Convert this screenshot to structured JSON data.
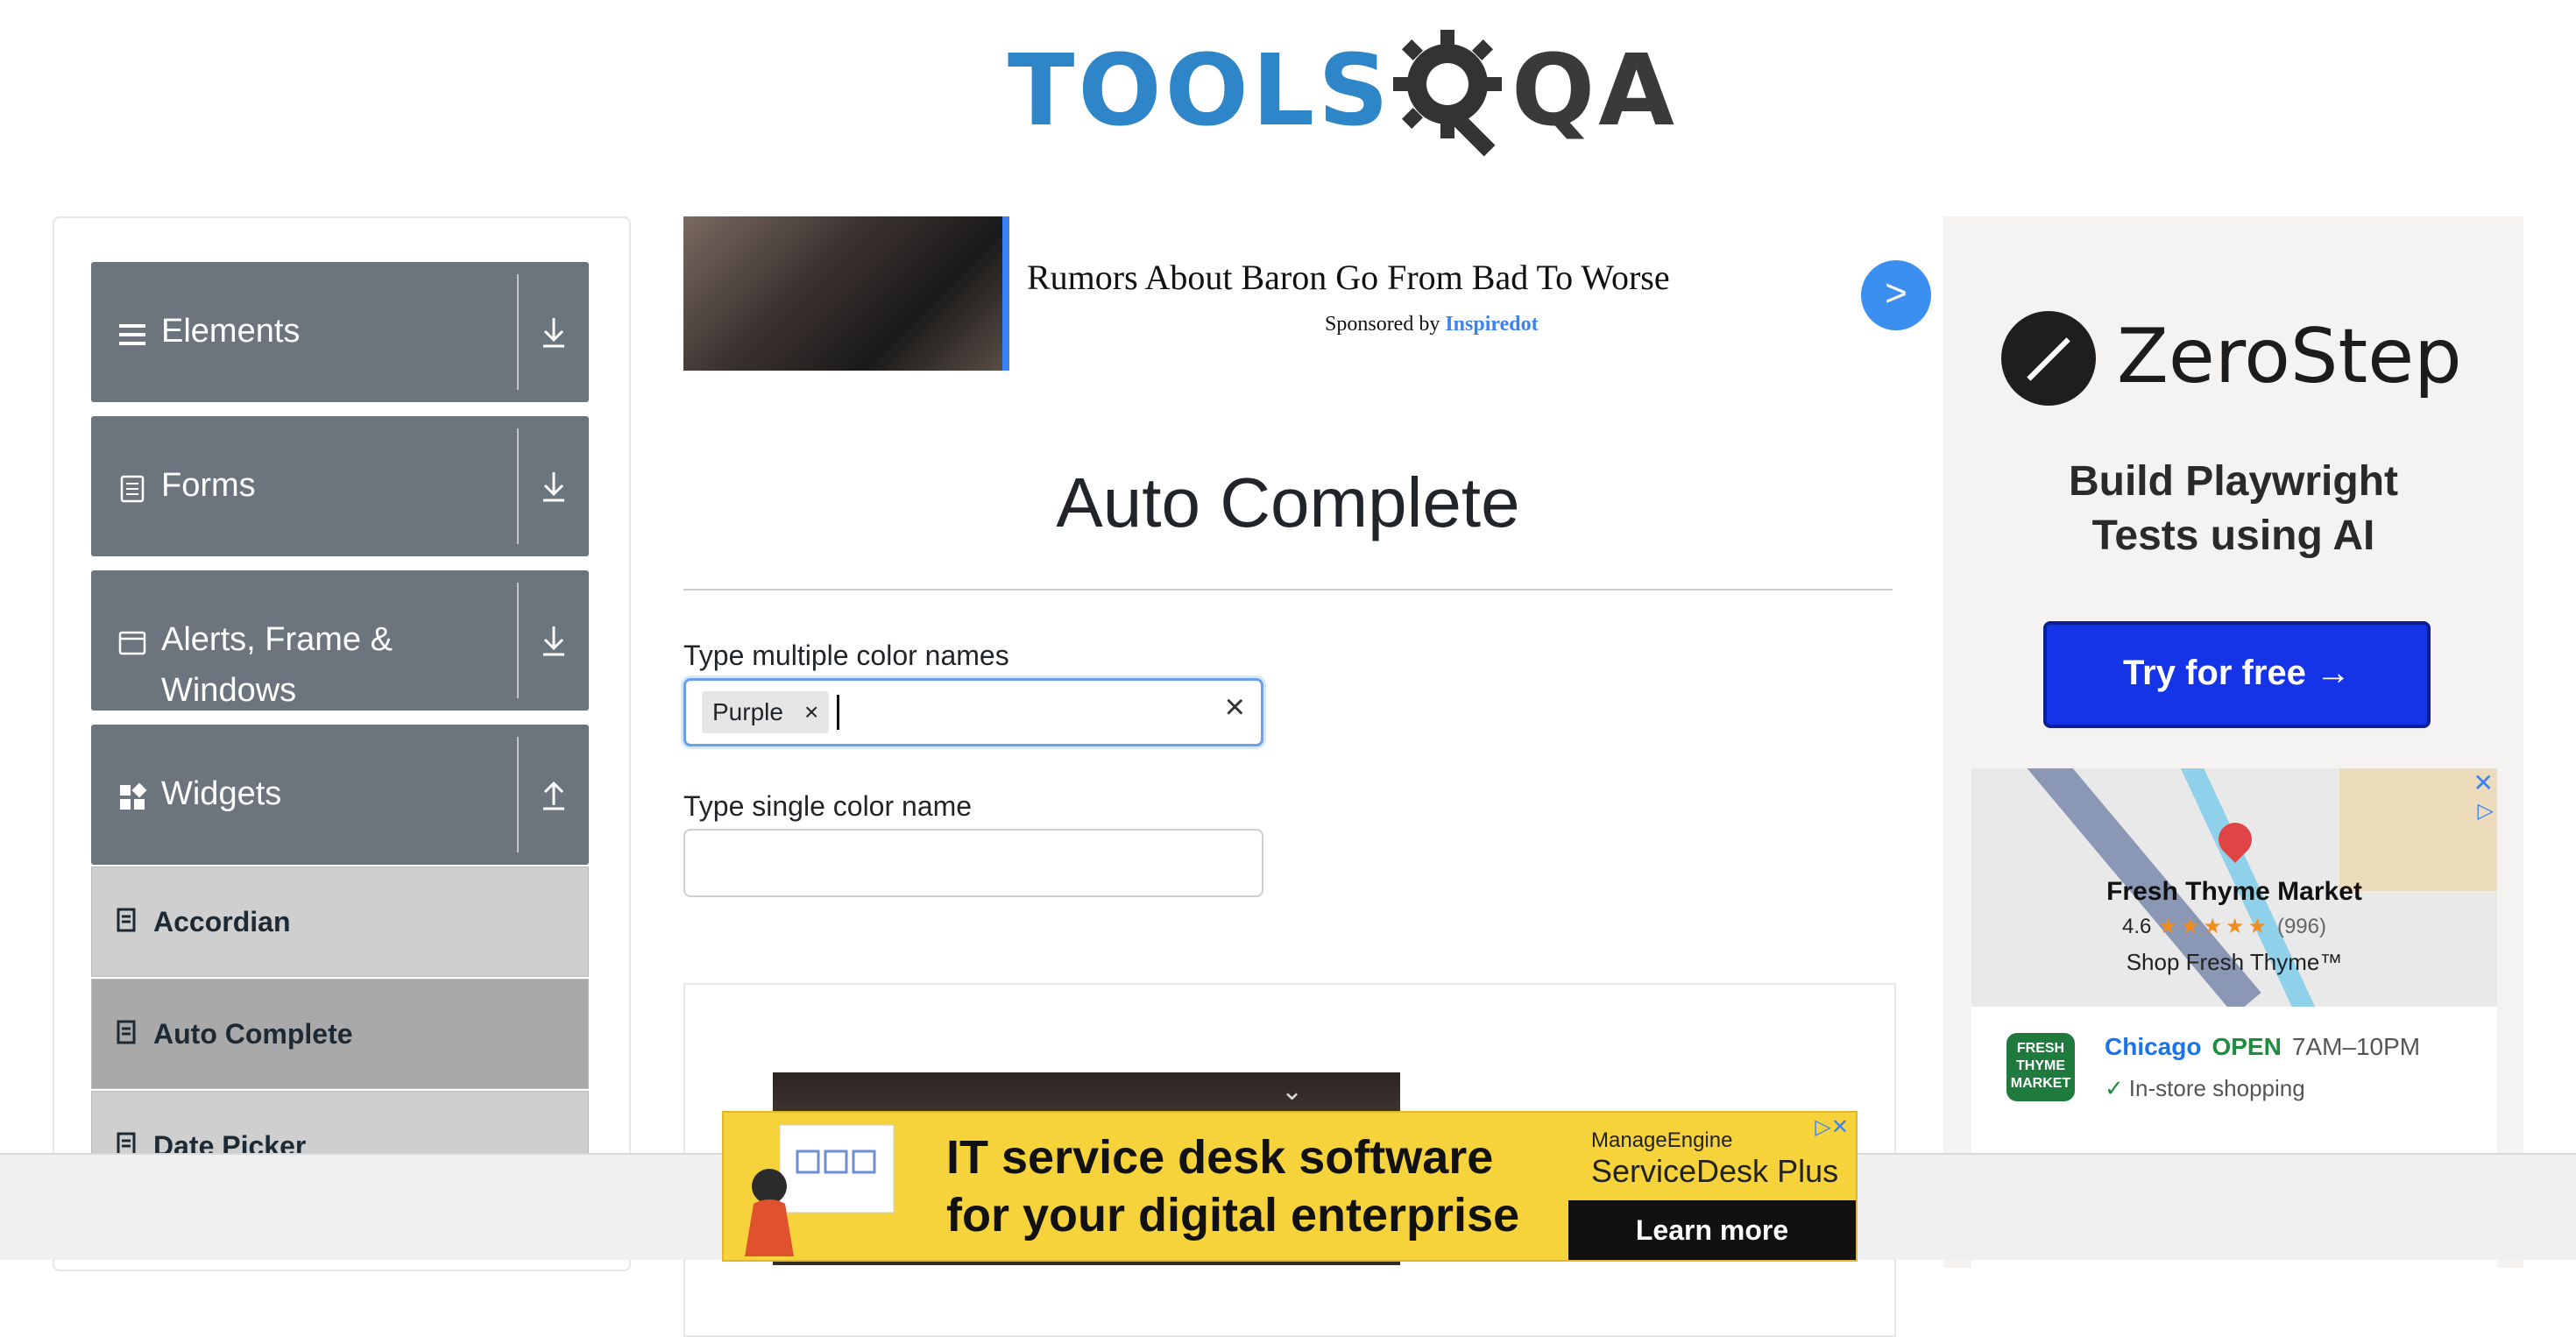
{
  "header": {
    "logo_left": "TOOLS",
    "logo_right": "QA"
  },
  "sidebar": {
    "groups": [
      {
        "label": "Elements"
      },
      {
        "label": "Forms"
      },
      {
        "label_line1": "Alerts, Frame &",
        "label_line2": "Windows"
      },
      {
        "label": "Widgets"
      }
    ],
    "items": [
      {
        "label": "Accordian"
      },
      {
        "label": "Auto Complete"
      },
      {
        "label": "Date Picker"
      }
    ]
  },
  "top_ad": {
    "headline": "Rumors About Baron Go From Bad To Worse",
    "sponsored_prefix": "Sponsored by",
    "sponsor": "Inspiredot",
    "next_label": ">"
  },
  "main": {
    "title": "Auto Complete",
    "multi_label": "Type multiple color names",
    "multi_chip": "Purple",
    "chip_remove": "×",
    "clear_label": "×",
    "single_label": "Type single color name",
    "video_toggle": "⌄"
  },
  "right_ad": {
    "brand": "ZeroStep",
    "tagline_line1": "Build Playwright",
    "tagline_line2": "Tests using AI",
    "cta": "Try for free →",
    "close": "✕",
    "adchoice": "▷",
    "place_name": "Fresh Thyme Market",
    "rating": "4.6",
    "stars": "★★★★★",
    "reviews": "(996)",
    "place_sub": "Shop Fresh Thyme™",
    "store_logo": "FRESH THYME MARKET",
    "city": "Chicago",
    "status": "OPEN",
    "hours": "7AM–10PM",
    "feature_check": "✓",
    "feature": "In-store shopping"
  },
  "bottom_ad": {
    "line1": "IT service desk software",
    "line2": "for your digital enterprise",
    "brand_small": "ManageEngine",
    "brand_big": "ServiceDesk Plus",
    "cta": "Learn more",
    "icons": "▷✕"
  },
  "colors": {
    "sidebar_group": "#6c757d",
    "sidebar_item": "#cfcfcf",
    "sidebar_item_active": "#a9a9a9",
    "accent_blue": "#3b82f6",
    "zerostep_cta": "#1534e8",
    "bottom_ad_bg": "#f7d33b"
  }
}
